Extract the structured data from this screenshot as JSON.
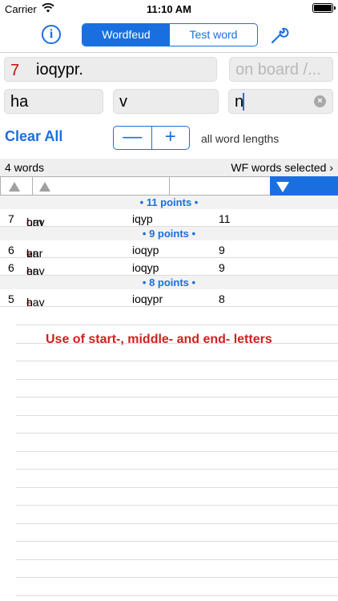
{
  "status": {
    "carrier": "Carrier",
    "time": "11:10 AM"
  },
  "toolbar": {
    "info_label": "i",
    "tabs": [
      {
        "label": "Wordfeud",
        "active": true
      },
      {
        "label": "Test word",
        "active": false
      }
    ]
  },
  "inputs": {
    "letter_count": "7",
    "letters": "ioqypr.",
    "board_placeholder": "on board /...",
    "start": "ha",
    "middle": "v",
    "end": "n"
  },
  "controls": {
    "clear_all": "Clear All",
    "minus": "—",
    "plus": "+",
    "lengths": "all word lengths"
  },
  "info": {
    "count": "4 words",
    "selection": "WF words selected"
  },
  "groups": [
    {
      "header": "• 11 points •",
      "rows": [
        {
          "len": "7",
          "pre": "hav",
          "hl": "t",
          "post": "orn",
          "rem": "iqyp",
          "pts": "11"
        }
      ]
    },
    {
      "header": "• 9 points •",
      "rows": [
        {
          "len": "6",
          "pre": "har",
          "hl": "v",
          "post": "en",
          "rem": "ioqyp",
          "pts": "9"
        },
        {
          "len": "6",
          "pre": "hav",
          "hl": "r",
          "post": "en",
          "rem": "ioqyp",
          "pts": "9"
        }
      ]
    },
    {
      "header": "• 8 points •",
      "rows": [
        {
          "len": "5",
          "pre": "hav",
          "hl": "e",
          "post": "n",
          "rem": "ioqypr",
          "pts": "8"
        }
      ]
    }
  ],
  "caption": "Use of start-, middle- and end- letters",
  "colors": {
    "accent": "#1a6fe0",
    "highlight": "#c01010",
    "caption": "#d02020"
  }
}
